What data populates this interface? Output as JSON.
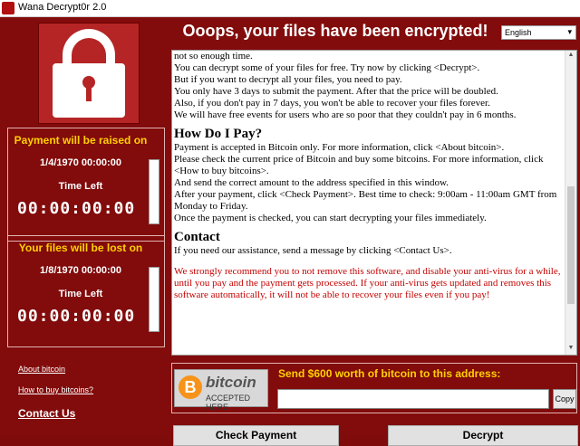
{
  "window": {
    "title": "Wana Decrypt0r 2.0"
  },
  "headline": "Ooops, your files have been encrypted!",
  "language": {
    "selected": "English"
  },
  "timers": [
    {
      "heading": "Payment will be raised on",
      "date": "1/4/1970 00:00:00",
      "time_left_label": "Time Left",
      "countdown": "00:00:00:00"
    },
    {
      "heading": "Your files will be lost on",
      "date": "1/8/1970 00:00:00",
      "time_left_label": "Time Left",
      "countdown": "00:00:00:00"
    }
  ],
  "links": {
    "about_bitcoin": "About bitcoin",
    "how_to_buy": "How to buy bitcoins?",
    "contact_us": "Contact Us"
  },
  "message": {
    "intro_lines": [
      "not so enough time.",
      "You can decrypt some of your files for free. Try now by clicking <Decrypt>.",
      "But if you want to decrypt all your files, you need to pay.",
      "You only have 3 days to submit the payment. After that the price will be doubled.",
      "Also, if you don't pay in 7 days, you won't be able to recover your files forever.",
      "We will have free events for users who are so poor that they couldn't pay in 6 months."
    ],
    "howto_heading": "How Do I Pay?",
    "howto_lines": [
      "Payment is accepted in Bitcoin only. For more information, click <About bitcoin>.",
      "Please check the current price of Bitcoin and buy some bitcoins. For more information, click <How to buy bitcoins>.",
      "And send the correct amount to the address specified in this window.",
      "After your payment, click <Check Payment>. Best time to check: 9:00am - 11:00am GMT from Monday to Friday.",
      "Once the payment is checked, you can start decrypting your files immediately."
    ],
    "contact_heading": "Contact",
    "contact_line": "If you need our assistance, send a message by clicking <Contact Us>.",
    "warning": "We strongly recommend you to not remove this software, and disable your anti-virus for a while, until you pay and the payment gets processed. If your anti-virus gets updated and removes this software automatically, it will not be able to recover your files even if you pay!"
  },
  "bitcoin": {
    "logo_symbol": "B",
    "logo_word": "bitcoin",
    "logo_accept": "ACCEPTED HERE",
    "send_label": "Send $600 worth of bitcoin to this address:",
    "address": "",
    "copy_label": "Copy"
  },
  "buttons": {
    "check_payment": "Check Payment",
    "decrypt": "Decrypt"
  },
  "colors": {
    "background": "#820b0b",
    "accent": "#ffd000",
    "warning_text": "#c40000"
  }
}
